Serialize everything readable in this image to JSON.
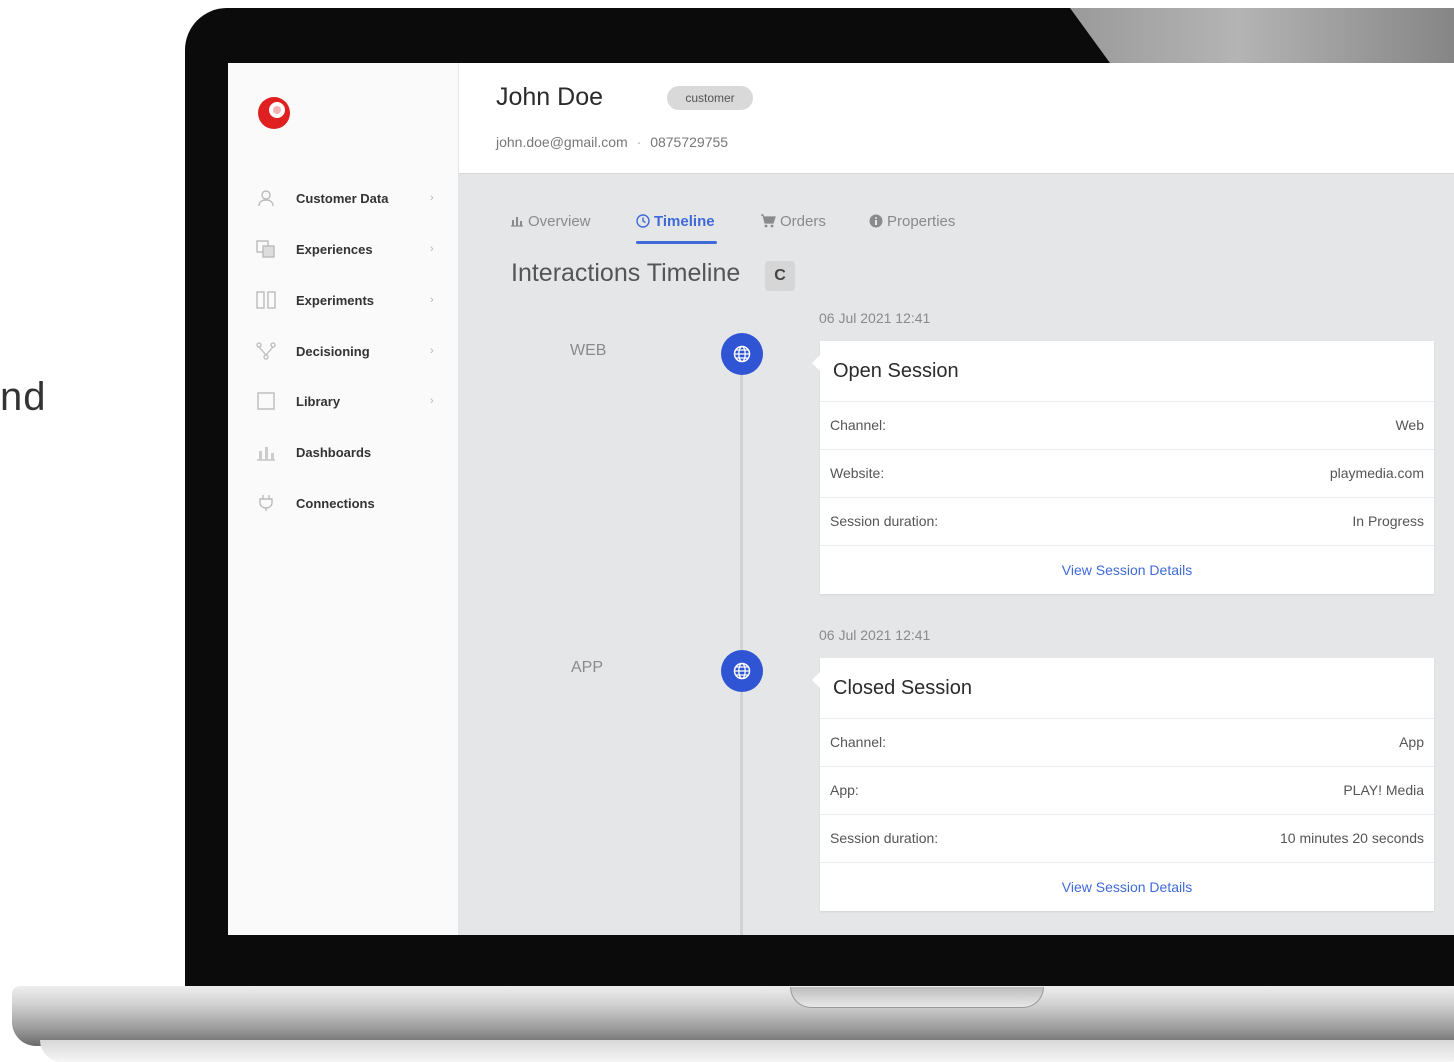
{
  "background_text": "nd",
  "sidebar": {
    "items": [
      {
        "label": "Customer Data",
        "icon": "user-icon",
        "has_chevron": true
      },
      {
        "label": "Experiences",
        "icon": "layers-icon",
        "has_chevron": true
      },
      {
        "label": "Experiments",
        "icon": "columns-icon",
        "has_chevron": true
      },
      {
        "label": "Decisioning",
        "icon": "branch-icon",
        "has_chevron": true
      },
      {
        "label": "Library",
        "icon": "square-icon",
        "has_chevron": true
      },
      {
        "label": "Dashboards",
        "icon": "bar-chart-icon",
        "has_chevron": false
      },
      {
        "label": "Connections",
        "icon": "plug-icon",
        "has_chevron": false
      }
    ],
    "chevron": "›"
  },
  "header": {
    "name": "John Doe",
    "badge": "customer",
    "email": "john.doe@gmail.com",
    "separator": "·",
    "phone": "0875729755"
  },
  "tabs": [
    {
      "label": "Overview",
      "icon": "bar-chart-icon",
      "active": false
    },
    {
      "label": "Timeline",
      "icon": "clock-icon",
      "active": true
    },
    {
      "label": "Orders",
      "icon": "cart-icon",
      "active": false
    },
    {
      "label": "Properties",
      "icon": "info-icon",
      "active": false
    }
  ],
  "timeline": {
    "title": "Interactions Timeline",
    "refresh_glyph": "C",
    "events": [
      {
        "channel_label": "WEB",
        "timestamp": "06 Jul 2021 12:41",
        "title": "Open Session",
        "rows": [
          {
            "key": "Channel:",
            "value": "Web"
          },
          {
            "key": "Website:",
            "value": "playmedia.com"
          },
          {
            "key": "Session duration:",
            "value": "In Progress"
          }
        ],
        "link": "View Session Details"
      },
      {
        "channel_label": "APP",
        "timestamp": "06 Jul 2021 12:41",
        "title": "Closed Session",
        "rows": [
          {
            "key": "Channel:",
            "value": "App"
          },
          {
            "key": "App:",
            "value": "PLAY! Media"
          },
          {
            "key": "Session duration:",
            "value": "10 minutes 20 seconds"
          }
        ],
        "link": "View Session Details"
      }
    ]
  },
  "colors": {
    "accent": "#3f6ad8",
    "globe": "#2f55d4",
    "logo": "#e02020"
  }
}
